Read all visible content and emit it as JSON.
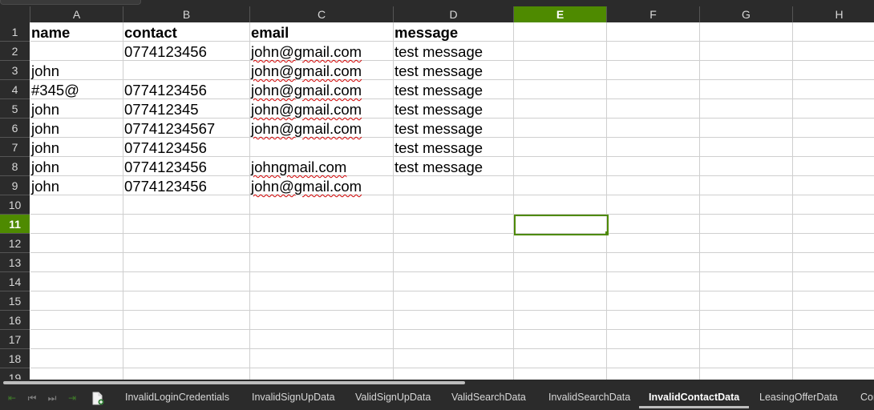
{
  "columns": [
    "A",
    "B",
    "C",
    "D",
    "E",
    "F",
    "G",
    "H"
  ],
  "selected_column": "E",
  "rows": [
    "1",
    "2",
    "3",
    "4",
    "5",
    "6",
    "7",
    "8",
    "9",
    "10",
    "11",
    "12",
    "13",
    "14",
    "15",
    "16",
    "17",
    "18",
    "19"
  ],
  "selected_row": "11",
  "cells": {
    "row1": [
      "name",
      "contact",
      "email",
      "message"
    ],
    "row2": [
      "",
      "0774123456",
      "john@gmail.com",
      "test message"
    ],
    "row3": [
      "john",
      "",
      "john@gmail.com",
      "test message"
    ],
    "row4": [
      "#345@",
      "0774123456",
      "john@gmail.com",
      "test message"
    ],
    "row5": [
      "john",
      "077412345",
      "john@gmail.com",
      "test message"
    ],
    "row6": [
      "john",
      "07741234567",
      "john@gmail.com",
      "test message"
    ],
    "row7": [
      "john",
      "0774123456",
      "",
      "test message"
    ],
    "row8": [
      "john",
      "0774123456",
      "johngmail.com",
      "test message"
    ],
    "row9": [
      "john",
      "0774123456",
      "john@gmail.com",
      ""
    ]
  },
  "sheet_tabs": [
    "InvalidLoginCredentials",
    "InvalidSignUpData",
    "ValidSignUpData",
    "ValidSearchData",
    "InvalidSearchData",
    "InvalidContactData",
    "LeasingOfferData",
    "Con"
  ],
  "active_sheet": "InvalidContactData",
  "colors": {
    "accent": "#4e8a00",
    "header_bg": "#2b2b2b",
    "header_text": "#d7d7d7",
    "grid_line": "#cfcfcf",
    "spell_error": "#d00000"
  }
}
